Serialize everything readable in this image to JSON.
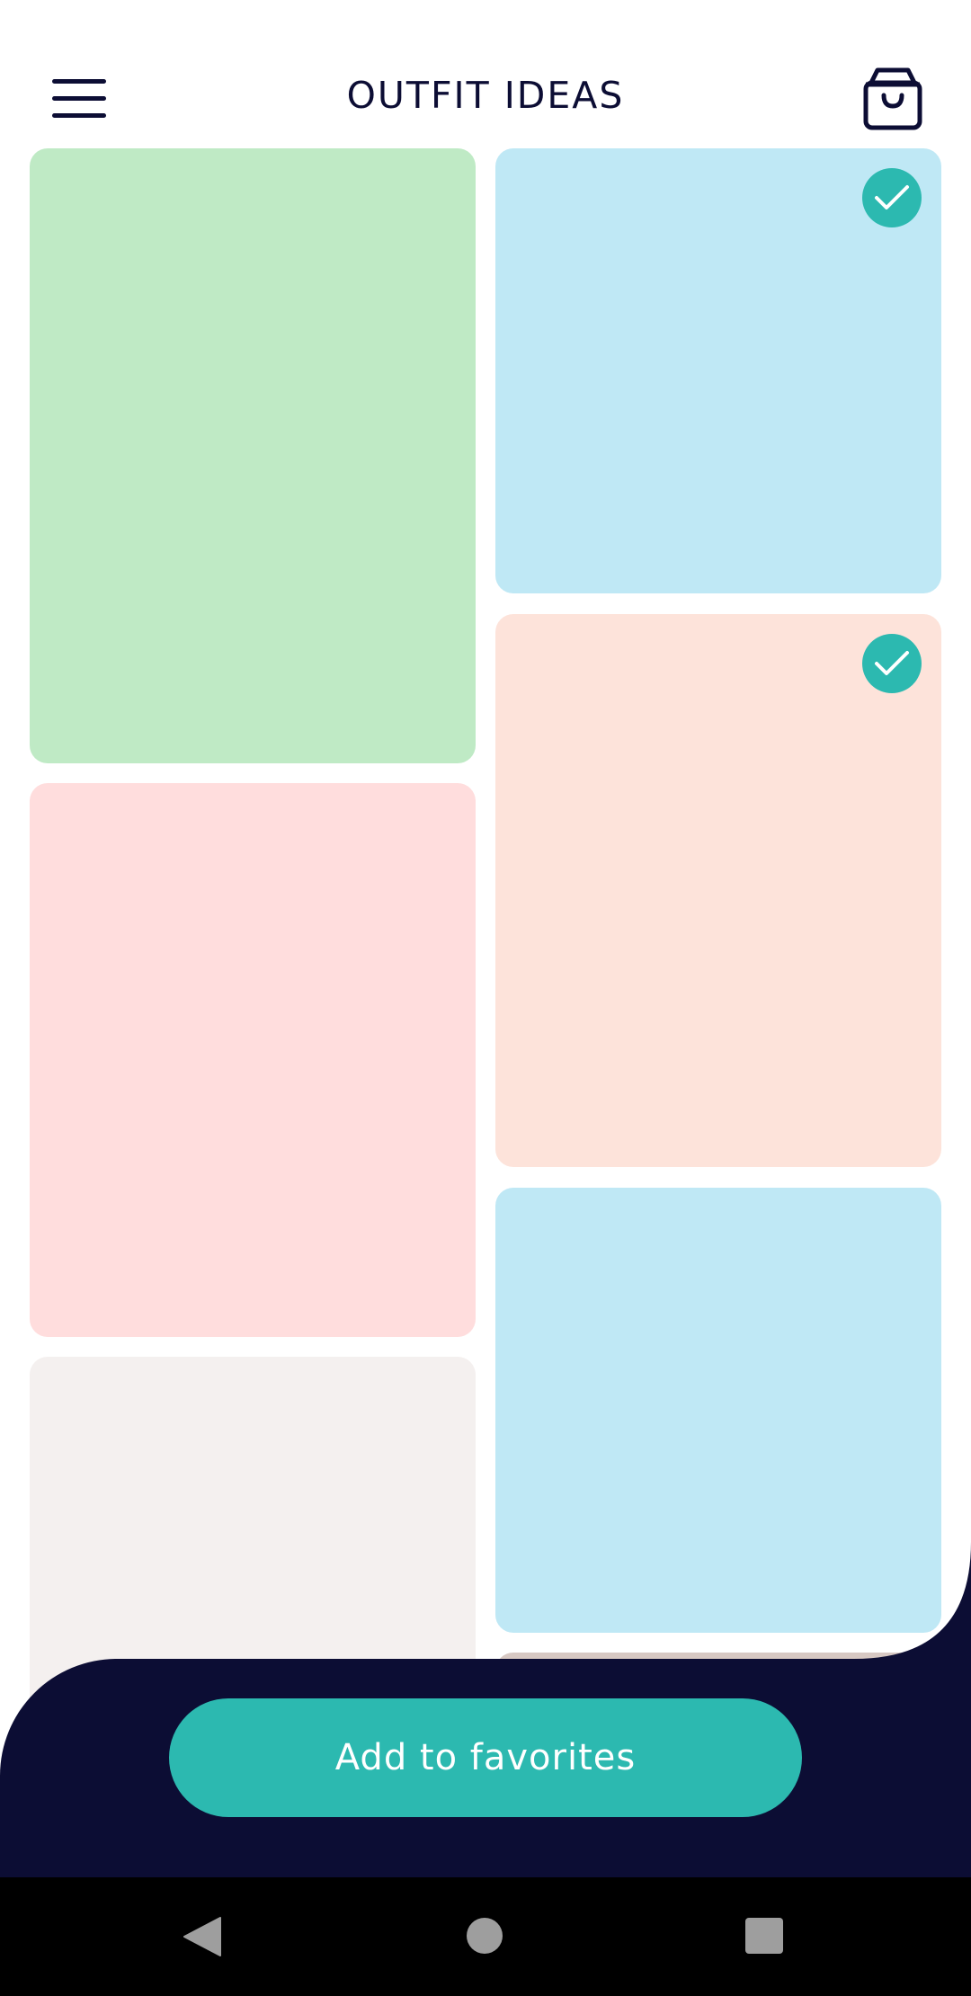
{
  "header": {
    "title": "OUTFIT IDEAS",
    "menu_icon": "hamburger-menu-icon",
    "cart_icon": "shopping-bag-icon",
    "text_color": "#0c0d34"
  },
  "grid": {
    "cards": [
      {
        "id": "card-1",
        "color": "#bfeac5",
        "selected": false
      },
      {
        "id": "card-2",
        "color": "#bfe8f5",
        "selected": true
      },
      {
        "id": "card-3",
        "color": "#ffdddd",
        "selected": false
      },
      {
        "id": "card-4",
        "color": "#fde3da",
        "selected": true
      },
      {
        "id": "card-5",
        "color": "#f4f0ef",
        "selected": false
      },
      {
        "id": "card-6",
        "color": "#bfe8f5",
        "selected": false
      },
      {
        "id": "card-7",
        "color": "#d7c8c3",
        "selected": false
      }
    ],
    "check_color": "#2cb9b0"
  },
  "footer": {
    "button_label": "Add to favorites",
    "panel_color": "#0c0d34",
    "button_color": "#2cb9b0"
  },
  "system_nav": {
    "back_icon": "back-triangle-icon",
    "home_icon": "home-circle-icon",
    "recents_icon": "recents-square-icon"
  }
}
